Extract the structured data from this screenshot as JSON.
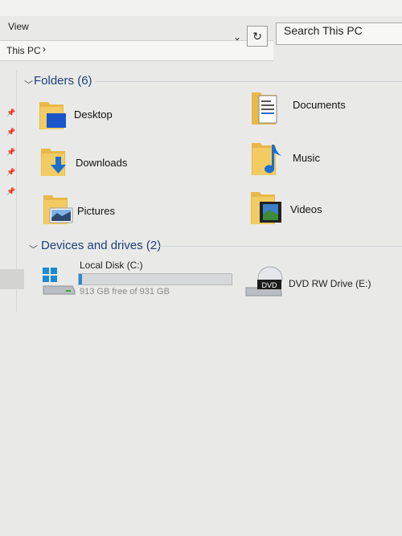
{
  "toolbar": {
    "view_tab": "View"
  },
  "address": {
    "crumb": "This PC",
    "crumb_sep": "›"
  },
  "search": {
    "placeholder": "Search This PC"
  },
  "folders_group": {
    "title": "Folders",
    "count": "(6)",
    "items": [
      {
        "label": "Desktop",
        "icon": "desktop-folder-icon"
      },
      {
        "label": "Documents",
        "icon": "documents-folder-icon"
      },
      {
        "label": "Downloads",
        "icon": "downloads-folder-icon"
      },
      {
        "label": "Music",
        "icon": "music-folder-icon"
      },
      {
        "label": "Pictures",
        "icon": "pictures-folder-icon"
      },
      {
        "label": "Videos",
        "icon": "videos-folder-icon"
      }
    ]
  },
  "devices_group": {
    "title": "Devices and drives",
    "count": "(2)",
    "drives": [
      {
        "name": "Local Disk (C:)",
        "free": "913 GB free of 931 GB",
        "used_fraction": 0.019,
        "icon": "windows-disk-icon"
      },
      {
        "name": "DVD RW Drive (E:)",
        "icon": "dvd-drive-icon",
        "badge": "DVD"
      }
    ]
  },
  "colors": {
    "accent": "#1d3f7a",
    "bar": "#2a8ad4",
    "folder": "#e8b84a"
  }
}
